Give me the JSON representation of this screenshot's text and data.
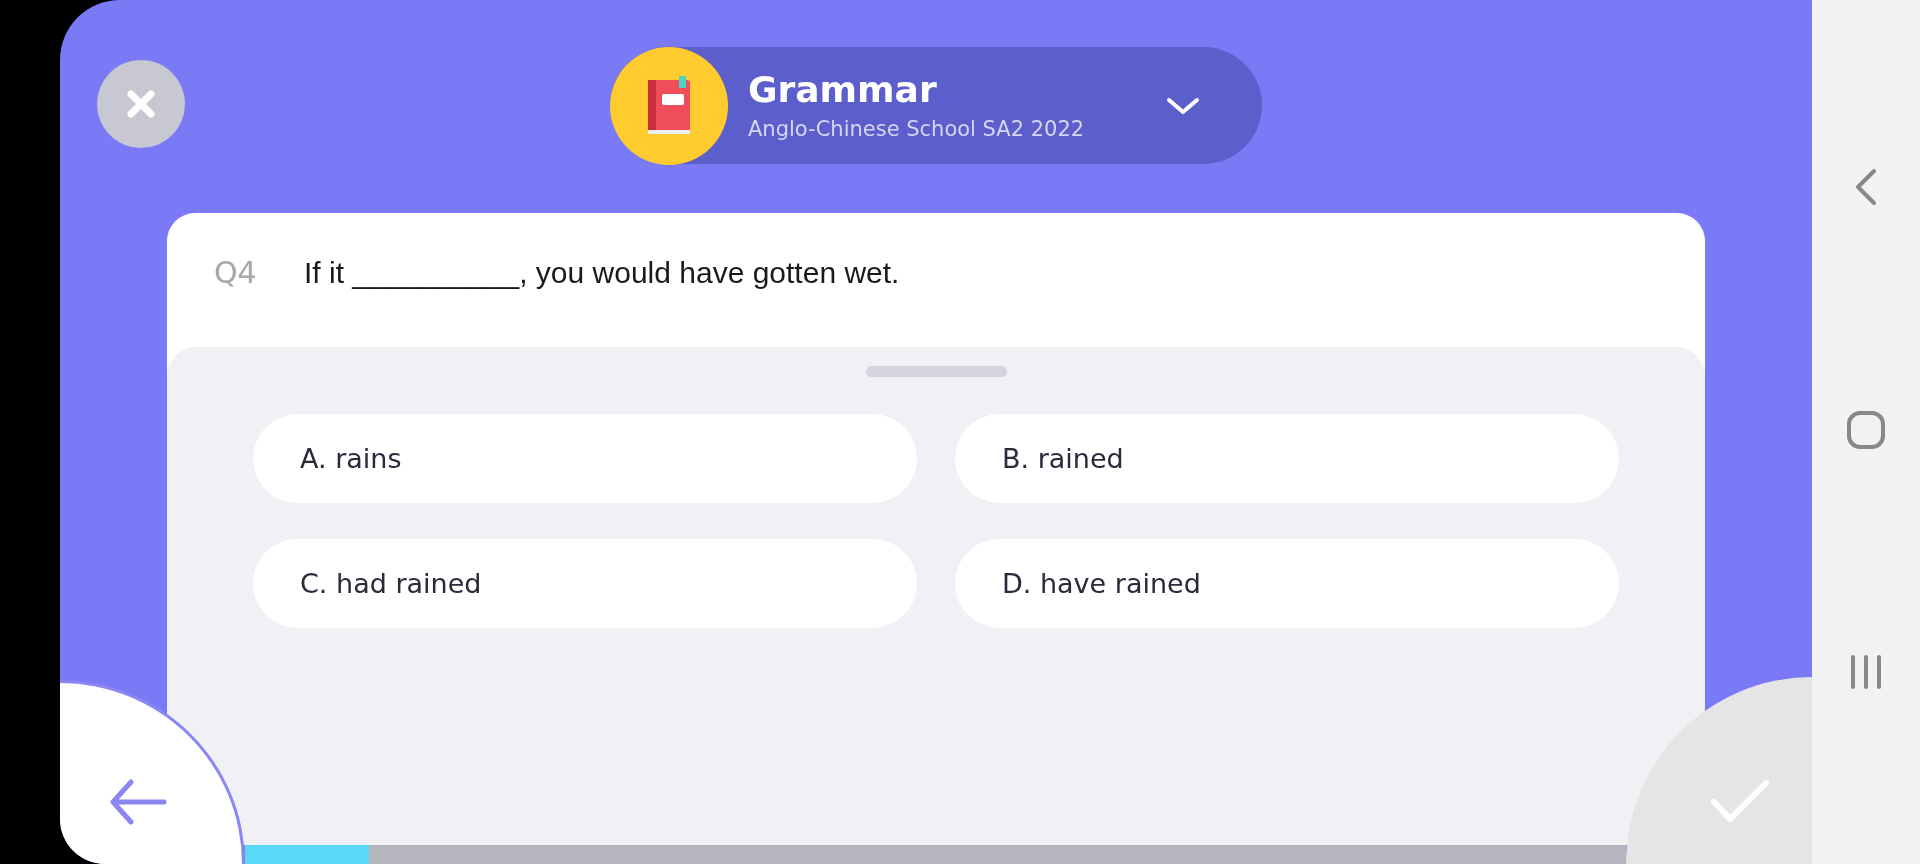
{
  "quiz": {
    "title": "Grammar",
    "source": "Anglo-Chinese School SA2 2022"
  },
  "question": {
    "number": "Q4",
    "text": "If it __________, you would have gotten wet."
  },
  "options": [
    {
      "label": "A. rains",
      "selected": false
    },
    {
      "label": "B. rained",
      "selected": false
    },
    {
      "label": "C. had rained",
      "selected": false
    },
    {
      "label": "D. have rained",
      "selected": false
    }
  ],
  "progress": {
    "level": 0.09
  }
}
